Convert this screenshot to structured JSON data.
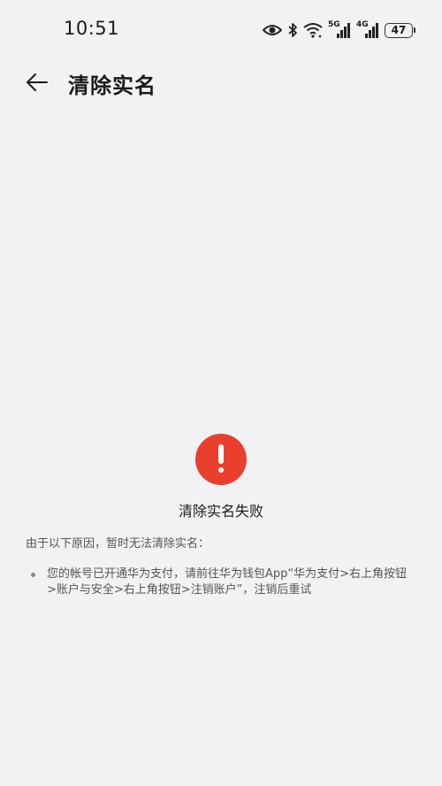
{
  "status_bar": {
    "time": "10:51",
    "network_1": "5G",
    "network_2": "4G",
    "battery": "47"
  },
  "header": {
    "title": "清除实名"
  },
  "result": {
    "title": "清除实名失败",
    "status_color": "#e8402c"
  },
  "reasons": {
    "intro": "由于以下原因，暂时无法清除实名：",
    "items": [
      "您的帐号已开通华为支付，请前往华为钱包App“华为支付>右上角按钮>账户与安全>右上角按钮>注销账户”，注销后重试"
    ]
  }
}
